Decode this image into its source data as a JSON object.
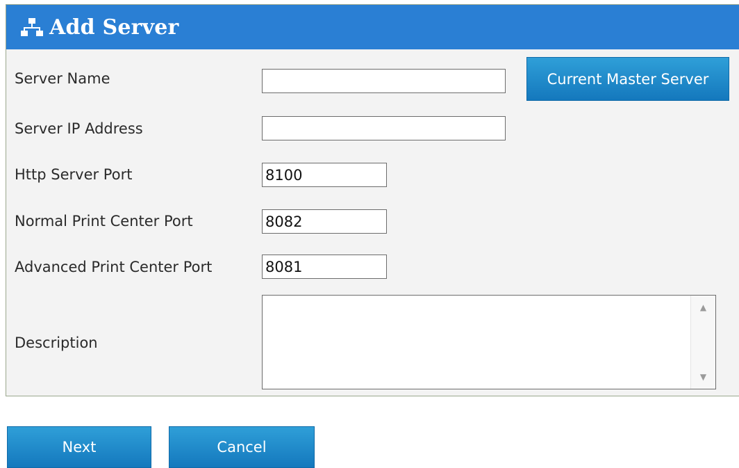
{
  "header": {
    "title": "Add Server",
    "icon": "network-icon"
  },
  "form": {
    "server_name": {
      "label": "Server Name",
      "value": ""
    },
    "server_ip": {
      "label": "Server IP Address",
      "value": ""
    },
    "http_port": {
      "label": "Http Server Port",
      "value": "8100"
    },
    "normal_print_port": {
      "label": "Normal Print Center Port",
      "value": "8082"
    },
    "advanced_print_port": {
      "label": "Advanced Print Center Port",
      "value": "8081"
    },
    "description": {
      "label": "Description",
      "value": ""
    },
    "master_button": "Current Master Server"
  },
  "footer": {
    "next_label": "Next",
    "cancel_label": "Cancel"
  },
  "colors": {
    "header_bg": "#2a7fd4",
    "button_bg": "#1a86c8",
    "panel_bg": "#f3f3f3"
  }
}
